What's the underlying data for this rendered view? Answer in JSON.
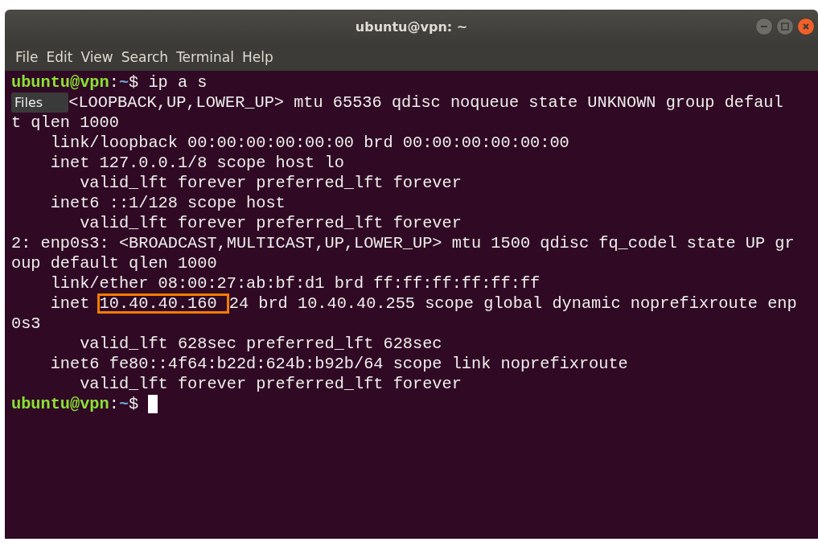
{
  "window": {
    "title": "ubuntu@vpn: ~"
  },
  "menu": [
    "File",
    "Edit",
    "View",
    "Search",
    "Terminal",
    "Help"
  ],
  "terminal": {
    "lines": [
      {
        "segments": [
          {
            "kind": "user",
            "text": "ubuntu@vpn"
          },
          {
            "kind": "text",
            "text": ":"
          },
          {
            "kind": "path",
            "text": "~"
          },
          {
            "kind": "text",
            "text": "$ ip a s"
          }
        ]
      },
      {
        "tooltip": "Files",
        "segments": [
          {
            "kind": "text",
            "text": "<LOOPBACK,UP,LOWER_UP> mtu 65536 qdisc noqueue state UNKNOWN group defaul"
          }
        ]
      },
      {
        "segments": [
          {
            "kind": "text",
            "text": "t qlen 1000"
          }
        ]
      },
      {
        "segments": [
          {
            "kind": "text",
            "text": "    link/loopback 00:00:00:00:00:00 brd 00:00:00:00:00:00"
          }
        ]
      },
      {
        "segments": [
          {
            "kind": "text",
            "text": "    inet 127.0.0.1/8 scope host lo"
          }
        ]
      },
      {
        "segments": [
          {
            "kind": "text",
            "text": "       valid_lft forever preferred_lft forever"
          }
        ]
      },
      {
        "segments": [
          {
            "kind": "text",
            "text": "    inet6 ::1/128 scope host"
          }
        ]
      },
      {
        "segments": [
          {
            "kind": "text",
            "text": "       valid_lft forever preferred_lft forever"
          }
        ]
      },
      {
        "segments": [
          {
            "kind": "text",
            "text": "2: enp0s3: <BROADCAST,MULTICAST,UP,LOWER_UP> mtu 1500 qdisc fq_codel state UP gr"
          }
        ]
      },
      {
        "segments": [
          {
            "kind": "text",
            "text": "oup default qlen 1000"
          }
        ]
      },
      {
        "segments": [
          {
            "kind": "text",
            "text": "    link/ether 08:00:27:ab:bf:d1 brd ff:ff:ff:ff:ff:ff"
          }
        ]
      },
      {
        "segments": [
          {
            "kind": "text",
            "text": "    inet "
          },
          {
            "kind": "highlight",
            "text": "10.40.40.160"
          },
          {
            "kind": "text",
            "text": "24 brd 10.40.40.255 scope global dynamic noprefixroute enp"
          }
        ]
      },
      {
        "segments": [
          {
            "kind": "text",
            "text": "0s3"
          }
        ]
      },
      {
        "segments": [
          {
            "kind": "text",
            "text": "       valid_lft 628sec preferred_lft 628sec"
          }
        ]
      },
      {
        "segments": [
          {
            "kind": "text",
            "text": "    inet6 fe80::4f64:b22d:624b:b92b/64 scope link noprefixroute"
          }
        ]
      },
      {
        "segments": [
          {
            "kind": "text",
            "text": "       valid_lft forever preferred_lft forever"
          }
        ]
      },
      {
        "cursor": true,
        "segments": [
          {
            "kind": "user",
            "text": "ubuntu@vpn"
          },
          {
            "kind": "text",
            "text": ":"
          },
          {
            "kind": "path",
            "text": "~"
          },
          {
            "kind": "text",
            "text": "$ "
          }
        ]
      }
    ]
  }
}
